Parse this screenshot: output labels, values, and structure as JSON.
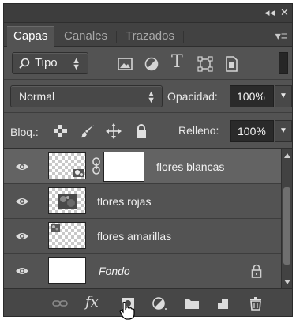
{
  "titlebar": {
    "collapse_glyph": "◂◂",
    "close_glyph": "✕"
  },
  "tabs": [
    {
      "label": "Capas",
      "active": true
    },
    {
      "label": "Canales",
      "active": false
    },
    {
      "label": "Trazados",
      "active": false
    }
  ],
  "panel_menu_glyph": "▾≡",
  "filter": {
    "kind_label": "Tipo",
    "icons": [
      "pixel-layer-filter-icon",
      "adjustment-layer-filter-icon",
      "type-layer-filter-icon",
      "shape-layer-filter-icon",
      "smart-object-filter-icon"
    ],
    "type_glyph": "T"
  },
  "blend": {
    "mode": "Normal",
    "opacity_label": "Opacidad:",
    "opacity_value": "100%"
  },
  "lock": {
    "label": "Bloq.:",
    "icons": [
      "lock-transparent-pixels-icon",
      "lock-image-pixels-icon",
      "lock-position-icon",
      "lock-all-icon"
    ],
    "fill_label": "Relleno:",
    "fill_value": "100%"
  },
  "layers": [
    {
      "name": "flores blancas",
      "visible": true,
      "selected": true,
      "has_mask": true,
      "italic": false,
      "locked": false
    },
    {
      "name": "flores rojas",
      "visible": true,
      "selected": false,
      "has_mask": false,
      "italic": false,
      "locked": false
    },
    {
      "name": "flores amarillas",
      "visible": true,
      "selected": false,
      "has_mask": false,
      "italic": false,
      "locked": false
    },
    {
      "name": "Fondo",
      "visible": true,
      "selected": false,
      "has_mask": false,
      "italic": true,
      "locked": true
    }
  ],
  "bottom_icons": [
    "link-layers-icon",
    "layer-style-fx-icon",
    "add-mask-icon",
    "adjustment-layer-icon",
    "new-group-icon",
    "new-layer-icon",
    "delete-layer-icon"
  ],
  "fx_glyph": "fx",
  "colors": {
    "panel_bg": "#535353",
    "selected_layer": "#636363",
    "tab_bar": "#424242"
  }
}
